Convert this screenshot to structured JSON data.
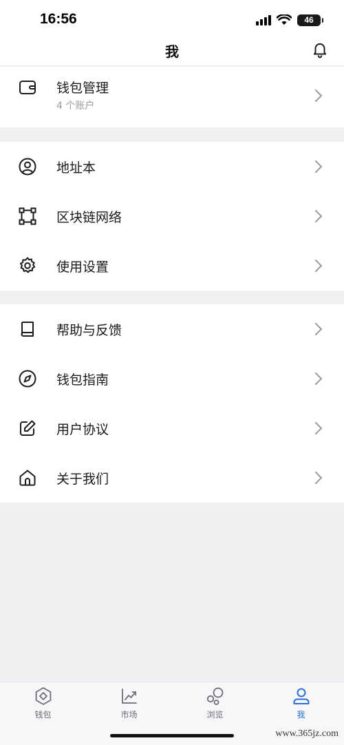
{
  "status": {
    "time": "16:56",
    "battery": "46"
  },
  "header": {
    "title": "我"
  },
  "wallet": {
    "label": "钱包管理",
    "sub": "4 个账户"
  },
  "section1": [
    {
      "label": "地址本",
      "icon": "user-circle-icon"
    },
    {
      "label": "区块链网络",
      "icon": "network-square-icon"
    },
    {
      "label": "使用设置",
      "icon": "gear-icon"
    }
  ],
  "section2": [
    {
      "label": "帮助与反馈",
      "icon": "book-icon"
    },
    {
      "label": "钱包指南",
      "icon": "compass-icon"
    },
    {
      "label": "用户协议",
      "icon": "edit-icon"
    },
    {
      "label": "关于我们",
      "icon": "home-icon"
    }
  ],
  "tabs": [
    {
      "label": "钱包",
      "icon": "wallet-hex-icon",
      "active": false
    },
    {
      "label": "市场",
      "icon": "chart-trend-icon",
      "active": false
    },
    {
      "label": "浏览",
      "icon": "bubbles-icon",
      "active": false
    },
    {
      "label": "我",
      "icon": "profile-icon",
      "active": true
    }
  ],
  "colors": {
    "accent": "#2a6fd6",
    "background": "#eff0f2",
    "text": "#1a1a1a",
    "muted": "#9a9aa0"
  },
  "watermark": "www.365jz.com"
}
